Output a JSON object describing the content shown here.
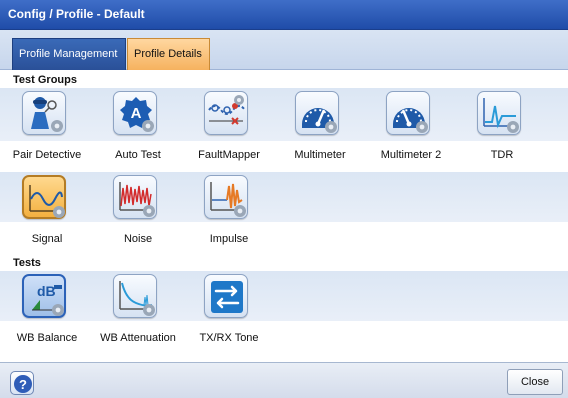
{
  "window": {
    "title": "Config / Profile - Default"
  },
  "tabs": [
    {
      "label": "Profile Management"
    },
    {
      "label": "Profile Details"
    }
  ],
  "test_groups": {
    "heading": "Test Groups",
    "items": [
      {
        "label": "Pair Detective",
        "icon": "pair-detective-icon"
      },
      {
        "label": "Auto Test",
        "icon": "auto-test-icon"
      },
      {
        "label": "FaultMapper",
        "icon": "faultmapper-icon"
      },
      {
        "label": "Multimeter",
        "icon": "multimeter-icon"
      },
      {
        "label": "Multimeter 2",
        "icon": "multimeter-2-icon"
      },
      {
        "label": "TDR",
        "icon": "tdr-icon"
      },
      {
        "label": "Signal",
        "icon": "signal-icon"
      },
      {
        "label": "Noise",
        "icon": "noise-icon"
      },
      {
        "label": "Impulse",
        "icon": "impulse-icon"
      }
    ]
  },
  "tests": {
    "heading": "Tests",
    "items": [
      {
        "label": "WB Balance",
        "icon": "wb-balance-icon"
      },
      {
        "label": "WB Attenuation",
        "icon": "wb-attenuation-icon"
      },
      {
        "label": "TX/RX Tone",
        "icon": "tx-rx-tone-icon"
      }
    ]
  },
  "footer": {
    "help_icon": "help-icon",
    "close_label": "Close"
  },
  "colors": {
    "title_bar": "#2f5db8",
    "active_tab": "#f6b25f",
    "accent": "#2c62b8",
    "band": "#dbe6f4"
  }
}
